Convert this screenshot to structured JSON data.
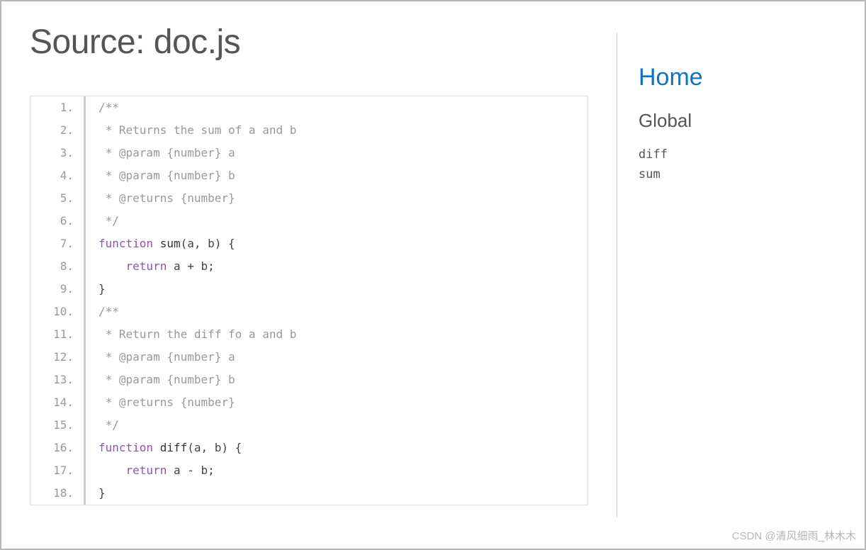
{
  "title": "Source: doc.js",
  "sidebar": {
    "home": "Home",
    "section": "Global",
    "items": [
      "diff",
      "sum"
    ]
  },
  "watermark": "CSDN @清风细雨_林木木",
  "code": [
    {
      "n": "1.",
      "tokens": [
        {
          "cls": "com",
          "t": "/**"
        }
      ]
    },
    {
      "n": "2.",
      "tokens": [
        {
          "cls": "com",
          "t": " * Returns the sum of a and b"
        }
      ]
    },
    {
      "n": "3.",
      "tokens": [
        {
          "cls": "com",
          "t": " * @param {number} a"
        }
      ]
    },
    {
      "n": "4.",
      "tokens": [
        {
          "cls": "com",
          "t": " * @param {number} b"
        }
      ]
    },
    {
      "n": "5.",
      "tokens": [
        {
          "cls": "com",
          "t": " * @returns {number}"
        }
      ]
    },
    {
      "n": "6.",
      "tokens": [
        {
          "cls": "com",
          "t": " */"
        }
      ]
    },
    {
      "n": "7.",
      "tokens": [
        {
          "cls": "kw",
          "t": "function"
        },
        {
          "cls": "pn",
          "t": " "
        },
        {
          "cls": "fn",
          "t": "sum"
        },
        {
          "cls": "pn",
          "t": "(a, b) {"
        }
      ]
    },
    {
      "n": "8.",
      "tokens": [
        {
          "cls": "pn",
          "t": "    "
        },
        {
          "cls": "kw",
          "t": "return"
        },
        {
          "cls": "pn",
          "t": " a "
        },
        {
          "cls": "op",
          "t": "+"
        },
        {
          "cls": "pn",
          "t": " b;"
        }
      ]
    },
    {
      "n": "9.",
      "tokens": [
        {
          "cls": "pn",
          "t": "}"
        }
      ]
    },
    {
      "n": "10.",
      "tokens": [
        {
          "cls": "com",
          "t": "/**"
        }
      ]
    },
    {
      "n": "11.",
      "tokens": [
        {
          "cls": "com",
          "t": " * Return the diff fo a and b"
        }
      ]
    },
    {
      "n": "12.",
      "tokens": [
        {
          "cls": "com",
          "t": " * @param {number} a"
        }
      ]
    },
    {
      "n": "13.",
      "tokens": [
        {
          "cls": "com",
          "t": " * @param {number} b"
        }
      ]
    },
    {
      "n": "14.",
      "tokens": [
        {
          "cls": "com",
          "t": " * @returns {number}"
        }
      ]
    },
    {
      "n": "15.",
      "tokens": [
        {
          "cls": "com",
          "t": " */"
        }
      ]
    },
    {
      "n": "16.",
      "tokens": [
        {
          "cls": "kw",
          "t": "function"
        },
        {
          "cls": "pn",
          "t": " "
        },
        {
          "cls": "fn",
          "t": "diff"
        },
        {
          "cls": "pn",
          "t": "(a, b) {"
        }
      ]
    },
    {
      "n": "17.",
      "tokens": [
        {
          "cls": "pn",
          "t": "    "
        },
        {
          "cls": "kw",
          "t": "return"
        },
        {
          "cls": "pn",
          "t": " a "
        },
        {
          "cls": "op",
          "t": "-"
        },
        {
          "cls": "pn",
          "t": " b;"
        }
      ]
    },
    {
      "n": "18.",
      "tokens": [
        {
          "cls": "pn",
          "t": "}"
        }
      ]
    }
  ]
}
